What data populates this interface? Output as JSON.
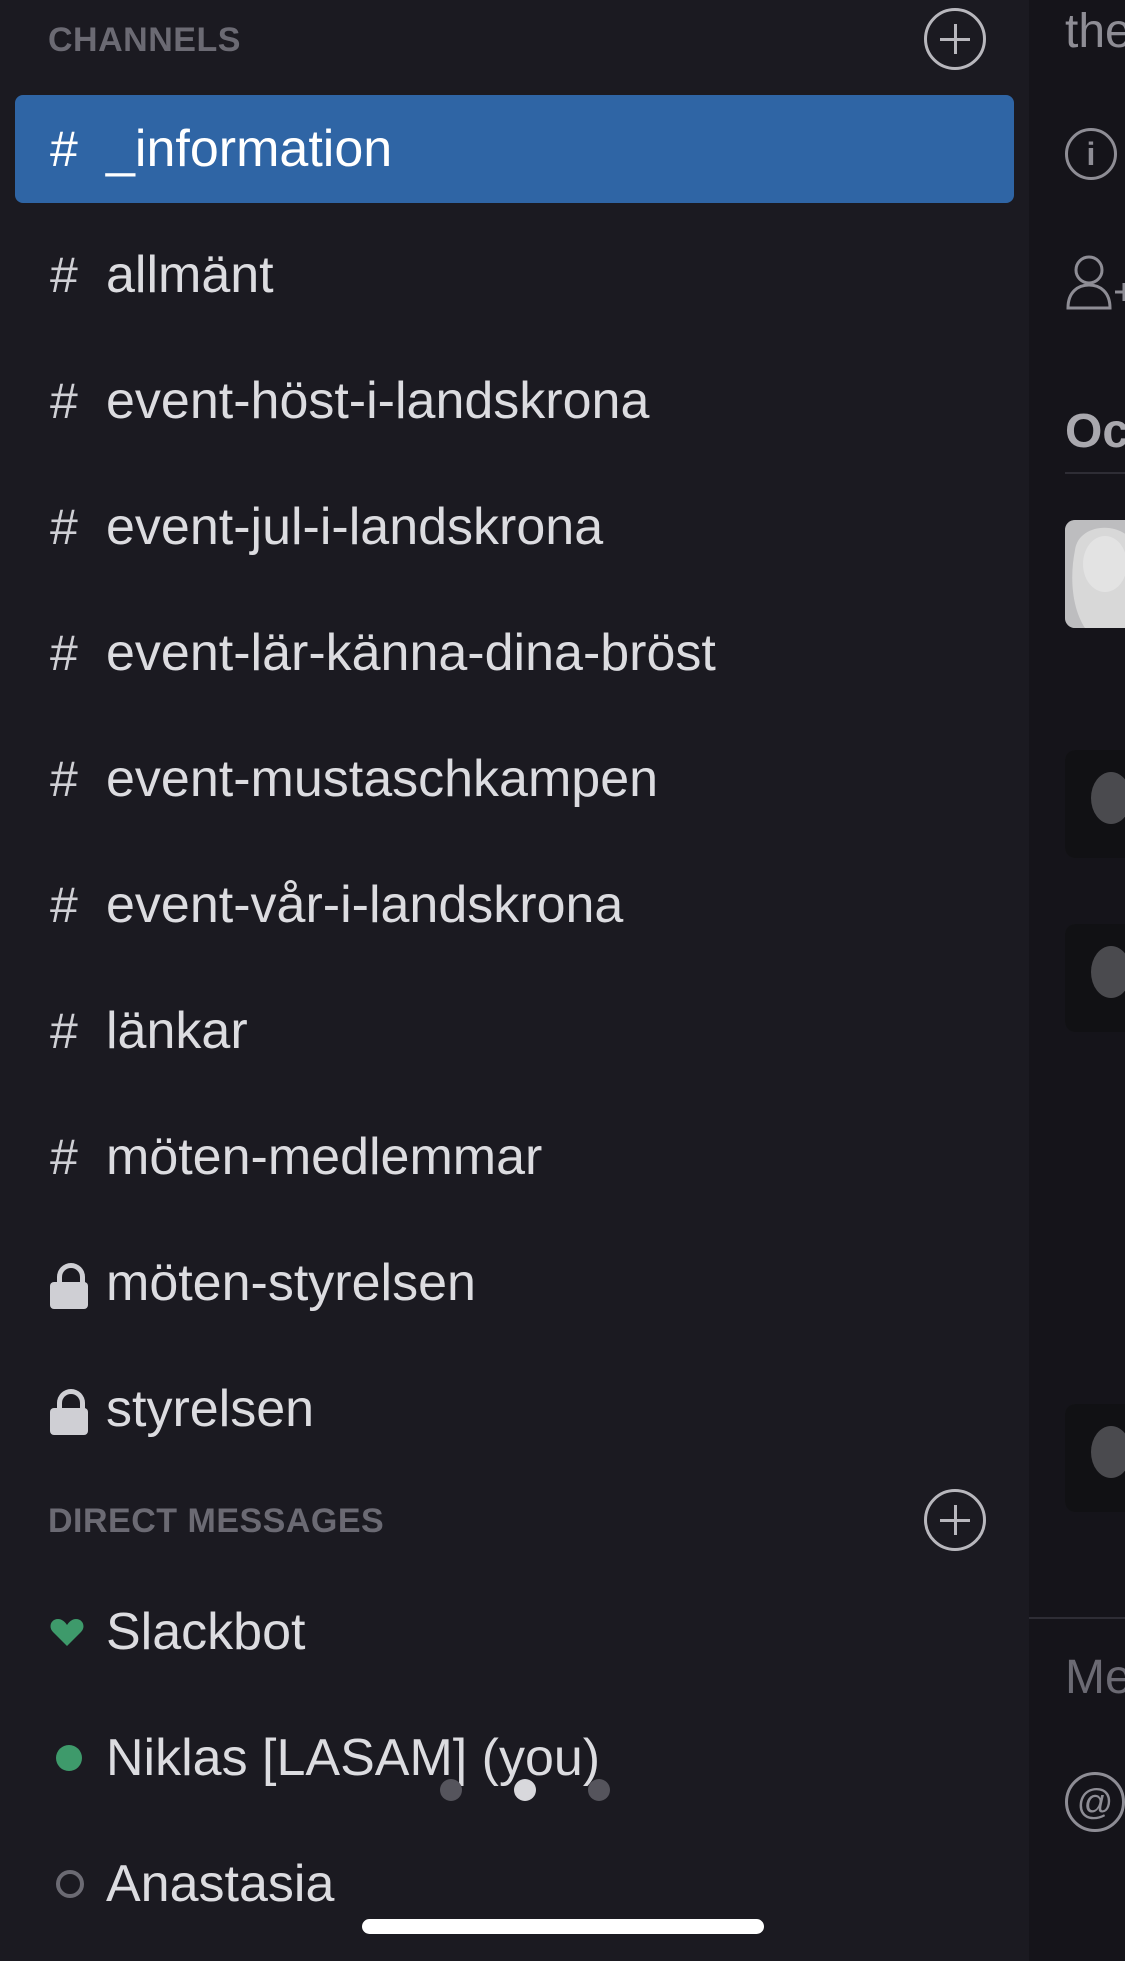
{
  "channels": {
    "header": "CHANNELS",
    "items": [
      {
        "label": "_information",
        "prefix": "#"
      },
      {
        "label": "allmänt",
        "prefix": "#"
      },
      {
        "label": "event-höst-i-landskrona",
        "prefix": "#"
      },
      {
        "label": "event-jul-i-landskrona",
        "prefix": "#"
      },
      {
        "label": "event-lär-känna-dina-bröst",
        "prefix": "#"
      },
      {
        "label": "event-mustaschkampen",
        "prefix": "#"
      },
      {
        "label": "event-vår-i-landskrona",
        "prefix": "#"
      },
      {
        "label": "länkar",
        "prefix": "#"
      },
      {
        "label": "möten-medlemmar",
        "prefix": "#"
      },
      {
        "label": "möten-styrelsen",
        "prefix": "lock-icon"
      },
      {
        "label": "styrelsen",
        "prefix": "lock-icon"
      }
    ]
  },
  "direct_messages": {
    "header": "DIRECT MESSAGES",
    "items": [
      {
        "label": "Slackbot",
        "status_icon": "heart-icon"
      },
      {
        "label": "Niklas [LASAM] (you)",
        "status_icon": "online-dot"
      },
      {
        "label": "Anastasia",
        "status_icon": "offline-ring"
      }
    ]
  },
  "right_panel": {
    "header_text": "the",
    "section_label": "Oc",
    "message_placeholder": "Me",
    "mention_icon": "@"
  },
  "colors": {
    "sidebar_bg": "#1b1a21",
    "active_channel_bg": "#2f65a5",
    "presence_online": "#3e9a6b"
  },
  "pager": {
    "current_page": 2,
    "total_pages": 3
  }
}
